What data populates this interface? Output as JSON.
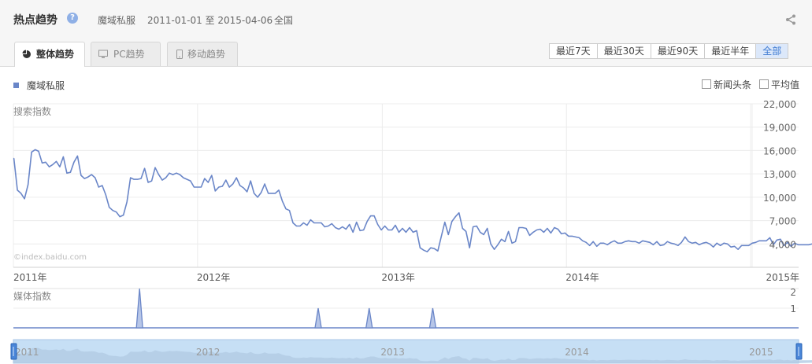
{
  "header": {
    "title": "热点趋势",
    "help_icon": "?",
    "keyword": "魔域私服",
    "date_range": "2011-01-01 至 2015-04-06",
    "region": "全国"
  },
  "tabs": [
    {
      "label": "整体趋势",
      "icon": "pie-chart-icon",
      "active": true
    },
    {
      "label": "PC趋势",
      "icon": "monitor-icon",
      "active": false
    },
    {
      "label": "移动趋势",
      "icon": "mobile-icon",
      "active": false
    }
  ],
  "ranges": [
    {
      "label": "最近7天",
      "selected": false
    },
    {
      "label": "最近30天",
      "selected": false
    },
    {
      "label": "最近90天",
      "selected": false
    },
    {
      "label": "最近半年",
      "selected": false
    },
    {
      "label": "全部",
      "selected": true
    }
  ],
  "toggles": {
    "news": "新闻头条",
    "average": "平均值"
  },
  "watermark": "©index.baidu.com",
  "colors": {
    "series": "#6a86c8",
    "fill": "#b7c6e8",
    "navigator": "#c6dff5",
    "accent": "#3d7ad1"
  },
  "chart_data": [
    {
      "type": "line",
      "title": "搜索指数",
      "xlabel": "",
      "ylabel": "",
      "x_ticks": [
        "2011年",
        "2012年",
        "2013年",
        "2014年",
        "2015年"
      ],
      "y_ticks": [
        "22,000",
        "19,000",
        "16,000",
        "13,000",
        "10,000",
        "7,000",
        "4,000"
      ],
      "ylim": [
        1000,
        22000
      ],
      "series": [
        {
          "x_start": "2011-01-02",
          "interval": "week",
          "values": [
            15000,
            10900,
            10500,
            9800,
            11600,
            15800,
            16100,
            15900,
            14400,
            14500,
            13900,
            14200,
            14600,
            13900,
            15200,
            13100,
            13200,
            14500,
            15300,
            12800,
            12400,
            12600,
            12900,
            12500,
            11300,
            11500,
            10300,
            8700,
            8300,
            8100,
            7500,
            7700,
            9400,
            12500,
            12300,
            12300,
            12400,
            13700,
            11900,
            12100,
            13800,
            12900,
            12200,
            12500,
            13100,
            12900,
            13100,
            12900,
            12500,
            12300,
            12100,
            11300,
            11300,
            11300,
            12400,
            11900,
            12800,
            10800,
            11300,
            11400,
            12200,
            11300,
            11700,
            12500,
            11500,
            11200,
            10700,
            12100,
            10500,
            10000,
            10600,
            11700,
            10500,
            10500,
            10500,
            10900,
            9500,
            8500,
            8300,
            6700,
            6300,
            6300,
            6700,
            6400,
            7100,
            6700,
            6700,
            6700,
            6200,
            6300,
            6600,
            6100,
            5900,
            6200,
            5900,
            6500,
            5500,
            6800,
            5700,
            5800,
            6900,
            7600,
            7600,
            6500,
            5800,
            6300,
            5800,
            5800,
            6400,
            5500,
            6000,
            5500,
            6100,
            5500,
            5700,
            3500,
            3200,
            3000,
            3500,
            3400,
            3100,
            5000,
            6800,
            5200,
            6900,
            7500,
            8000,
            6000,
            5600,
            3500,
            6200,
            6300,
            5500,
            5200,
            6000,
            4000,
            3300,
            3900,
            4600,
            4300,
            5600,
            4100,
            4300,
            6100,
            6100,
            6000,
            5100,
            5500,
            5800,
            5900,
            5500,
            6000,
            5400,
            6100,
            5900,
            5300,
            5400,
            5000,
            5000,
            4900,
            4800,
            4400,
            4200,
            3800,
            4300,
            3700,
            4100,
            4100,
            3900,
            4200,
            4400,
            4100,
            4100,
            4300,
            4400,
            4300,
            4300,
            4100,
            4400,
            4300,
            4200,
            3900,
            4300,
            3800,
            3900,
            4300,
            4100,
            4000,
            3800,
            4200,
            4900,
            4300,
            4100,
            4200,
            3900,
            4100,
            4200,
            4000,
            3600,
            4100,
            3800,
            4100,
            4000,
            3600,
            3700,
            3300,
            3800,
            3800,
            3800,
            4100,
            4200,
            4400,
            4400,
            4400,
            4800,
            3900,
            4500,
            4600,
            3800,
            4200,
            3700,
            4100,
            3900,
            3900,
            3900,
            3900,
            4000,
            4100,
            3800,
            4000,
            3600,
            3900,
            4700,
            4300,
            4300,
            4200,
            4100,
            3600,
            3100,
            3900,
            3600,
            3800,
            3900,
            3800,
            4200,
            4000,
            3800,
            3900,
            4000
          ]
        }
      ]
    },
    {
      "type": "line",
      "title": "媒体指数",
      "xlabel": "",
      "ylabel": "",
      "y_ticks": [
        "2",
        "1"
      ],
      "ylim": [
        0,
        2
      ],
      "events": [
        {
          "x": "2011-09-08",
          "y": 2
        },
        {
          "x": "2012-08-27",
          "y": 1
        },
        {
          "x": "2012-12-06",
          "y": 1
        },
        {
          "x": "2013-04-11",
          "y": 1
        }
      ]
    }
  ],
  "navigator": {
    "year_labels": [
      "2011",
      "2012",
      "2013",
      "2014",
      "2015"
    ]
  }
}
